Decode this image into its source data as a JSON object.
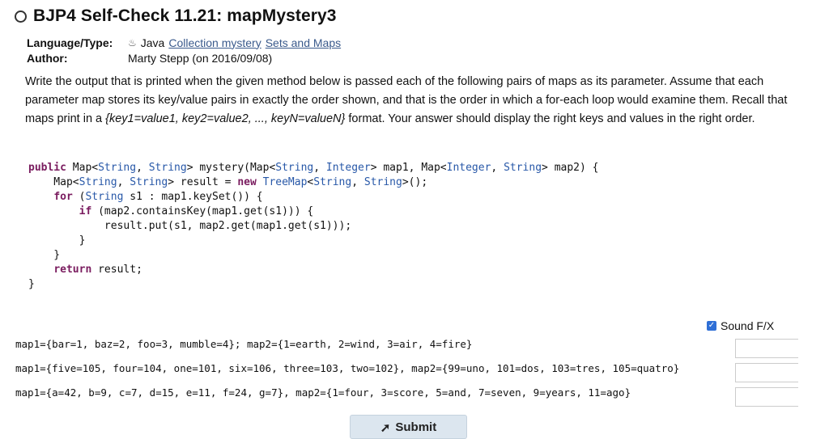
{
  "header": {
    "title": "BJP4 Self-Check 11.21: mapMystery3"
  },
  "meta": {
    "language_label": "Language/Type:",
    "language": "Java",
    "tag_1": "Collection mystery",
    "tag_2": "Sets and Maps",
    "author_label": "Author:",
    "author": "Marty Stepp (on 2016/09/08)"
  },
  "description": {
    "text_1": "Write the output that is printed when the given method below is passed each of the following pairs of maps as its parameter. Assume that each parameter map stores its key/value pairs in exactly the order shown, and that is the order in which a for-each loop would examine them. Recall that maps print in a ",
    "format": "{key1=value1, key2=value2, ..., keyN=valueN}",
    "text_2": " format. Your answer should display the right keys and values in the right order."
  },
  "code": {
    "l1_kw": "public",
    "l1_a": " Map<",
    "l1_t1": "String",
    "l1_b": ", ",
    "l1_t2": "String",
    "l1_c": "> mystery(Map<",
    "l1_t3": "String",
    "l1_d": ", ",
    "l1_t4": "Integer",
    "l1_e": "> map1, Map<",
    "l1_t5": "Integer",
    "l1_f": ", ",
    "l1_t6": "String",
    "l1_g": "> map2) {",
    "l2_a": "    Map<",
    "l2_t1": "String",
    "l2_b": ", ",
    "l2_t2": "String",
    "l2_c": "> result = ",
    "l2_kw": "new",
    "l2_d": " ",
    "l2_t3": "TreeMap",
    "l2_e": "<",
    "l2_t4": "String",
    "l2_f": ", ",
    "l2_t5": "String",
    "l2_g": ">();",
    "l3_a": "    ",
    "l3_kw": "for",
    "l3_b": " (",
    "l3_t1": "String",
    "l3_c": " s1 : map1.keySet()) {",
    "l4_a": "        ",
    "l4_kw": "if",
    "l4_b": " (map2.containsKey(map1.get(s1))) {",
    "l5": "            result.put(s1, map2.get(map1.get(s1)));",
    "l6": "        }",
    "l7": "    }",
    "l8_a": "    ",
    "l8_kw": "return",
    "l8_b": " result;",
    "l9": "}"
  },
  "sound": {
    "label": "Sound F/X",
    "checked": true
  },
  "pairs": [
    "map1={bar=1, baz=2, foo=3, mumble=4}; map2={1=earth, 2=wind, 3=air, 4=fire}",
    "map1={five=105, four=104, one=101, six=106, three=103, two=102}, map2={99=uno, 101=dos, 103=tres, 105=quatro}",
    "map1={a=42, b=9, c=7, d=15, e=11, f=24, g=7}, map2={1=four, 3=score, 5=and, 7=seven, 9=years, 11=ago}"
  ],
  "answers": [
    "",
    "",
    ""
  ],
  "submit": {
    "label": "Submit"
  },
  "colors": {
    "keyword": "#7a1c5f",
    "type": "#2858a8",
    "link": "#3a5a8c",
    "checkbox": "#2f6fd6"
  }
}
